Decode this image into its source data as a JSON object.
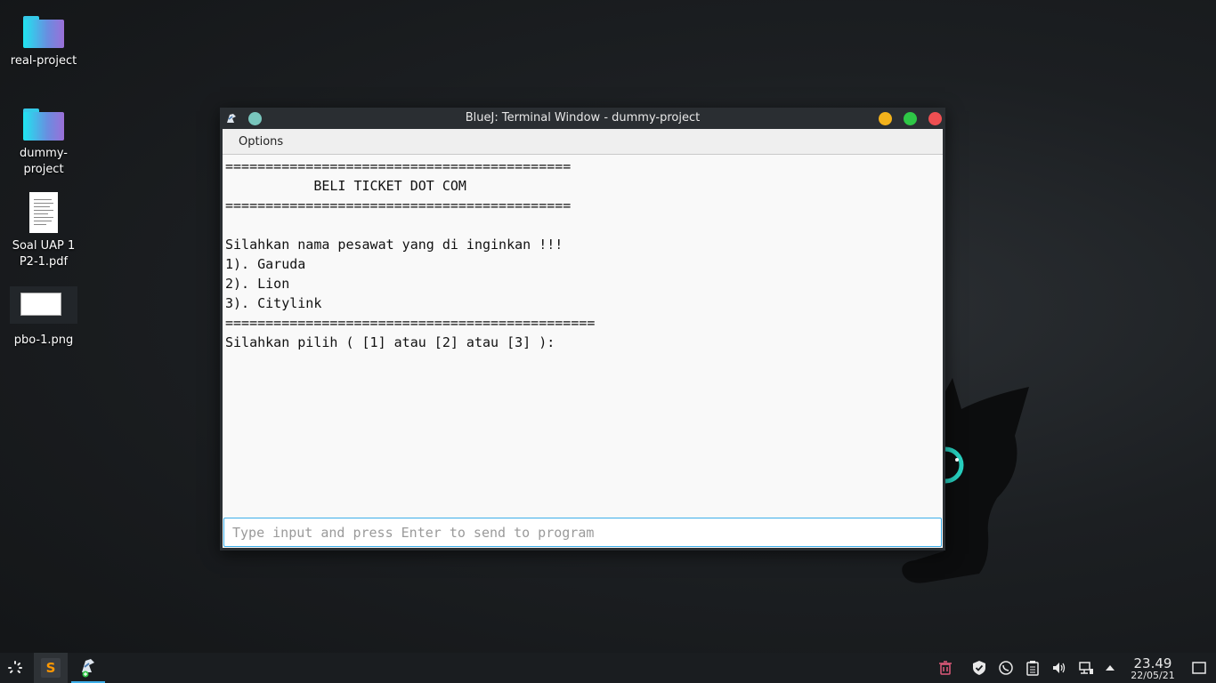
{
  "desktop": {
    "icons": [
      {
        "label": "real-project"
      },
      {
        "label": "dummy-\nproject"
      },
      {
        "label": "Soal UAP 1\nP2-1.pdf"
      },
      {
        "label": "pbo-1.png"
      }
    ]
  },
  "window": {
    "title": "BlueJ: Terminal Window - dummy-project",
    "menu": [
      "Options"
    ],
    "terminal_lines": [
      "===========================================",
      "           BELI TICKET DOT COM",
      "===========================================",
      "",
      "Silahkan nama pesawat yang di inginkan !!!",
      "1). Garuda",
      "2). Lion",
      "3). Citylink",
      "==============================================",
      "Silahkan pilih ( [1] atau [2] atau [3] ):"
    ],
    "input": {
      "value": "",
      "placeholder": "Type input and press Enter to send to program"
    }
  },
  "taskbar": {
    "clock_time": "23.49",
    "clock_date": "22/05/21"
  }
}
